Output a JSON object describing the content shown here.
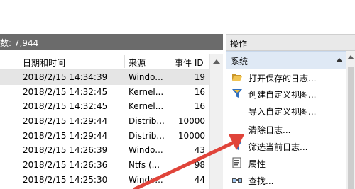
{
  "log_view": {
    "event_count_label": "数: 7,944",
    "columns": {
      "date": "日期和时间",
      "source": "来源",
      "event_id": "事件 ID"
    },
    "rows": [
      {
        "date": "2018/2/15 14:34:39",
        "source": "Windo...",
        "event_id": "19"
      },
      {
        "date": "2018/2/15 14:32:45",
        "source": "Kernel...",
        "event_id": "16"
      },
      {
        "date": "2018/2/15 14:32:45",
        "source": "Kernel...",
        "event_id": "16"
      },
      {
        "date": "2018/2/15 14:29:44",
        "source": "Distrib...",
        "event_id": "10000"
      },
      {
        "date": "2018/2/15 14:29:44",
        "source": "Distrib...",
        "event_id": "10000"
      },
      {
        "date": "2018/2/15 14:26:39",
        "source": "Windo...",
        "event_id": "43"
      },
      {
        "date": "2018/2/15 14:26:36",
        "source": "Ntfs (...",
        "event_id": "98"
      },
      {
        "date": "2018/2/15 14:25:30",
        "source": "Windo...",
        "event_id": "44"
      }
    ]
  },
  "actions_pane": {
    "title": "操作",
    "section": "系统",
    "items": [
      {
        "label": "打开保存的日志...",
        "icon": "folder-open-icon"
      },
      {
        "label": "创建自定义视图...",
        "icon": "filter-icon"
      },
      {
        "label": "导入自定义视图...",
        "icon": ""
      },
      {
        "label": "清除日志...",
        "icon": ""
      },
      {
        "label": "筛选当前日志...",
        "icon": "filter-icon"
      },
      {
        "label": "属性",
        "icon": "properties-icon"
      },
      {
        "label": "查找...",
        "icon": "find-icon"
      }
    ]
  },
  "colors": {
    "annotation_arrow": "#e0443a",
    "count_bar": "#6b6b6b",
    "selected_row": "#e5e5e5",
    "section_header": "#dfe9f5"
  }
}
